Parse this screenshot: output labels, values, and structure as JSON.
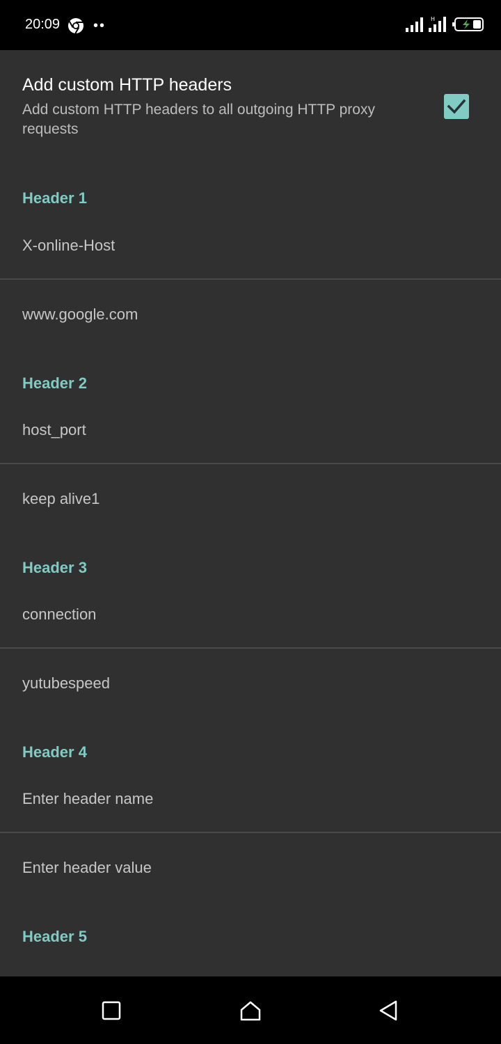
{
  "status_bar": {
    "time": "20:09",
    "icons": [
      "chrome-icon",
      "more-dots-icon",
      "signal-icon",
      "signal-hd-icon",
      "battery-charging-icon"
    ]
  },
  "preference": {
    "title": "Add custom HTTP headers",
    "summary": "Add custom HTTP headers to all outgoing HTTP proxy requests",
    "checked": true,
    "accent_color": "#80cbc4"
  },
  "headers": [
    {
      "label": "Header 1",
      "name": "X-online-Host",
      "value": "www.google.com"
    },
    {
      "label": "Header 2",
      "name": "host_port",
      "value": "keep alive1"
    },
    {
      "label": "Header 3",
      "name": "connection",
      "value": "yutubespeed"
    },
    {
      "label": "Header 4",
      "name_placeholder": "Enter header name",
      "value_placeholder": "Enter header value"
    },
    {
      "label": "Header 5"
    }
  ],
  "nav_bar": {
    "buttons": [
      "recents-square-icon",
      "home-icon",
      "back-triangle-icon"
    ]
  }
}
